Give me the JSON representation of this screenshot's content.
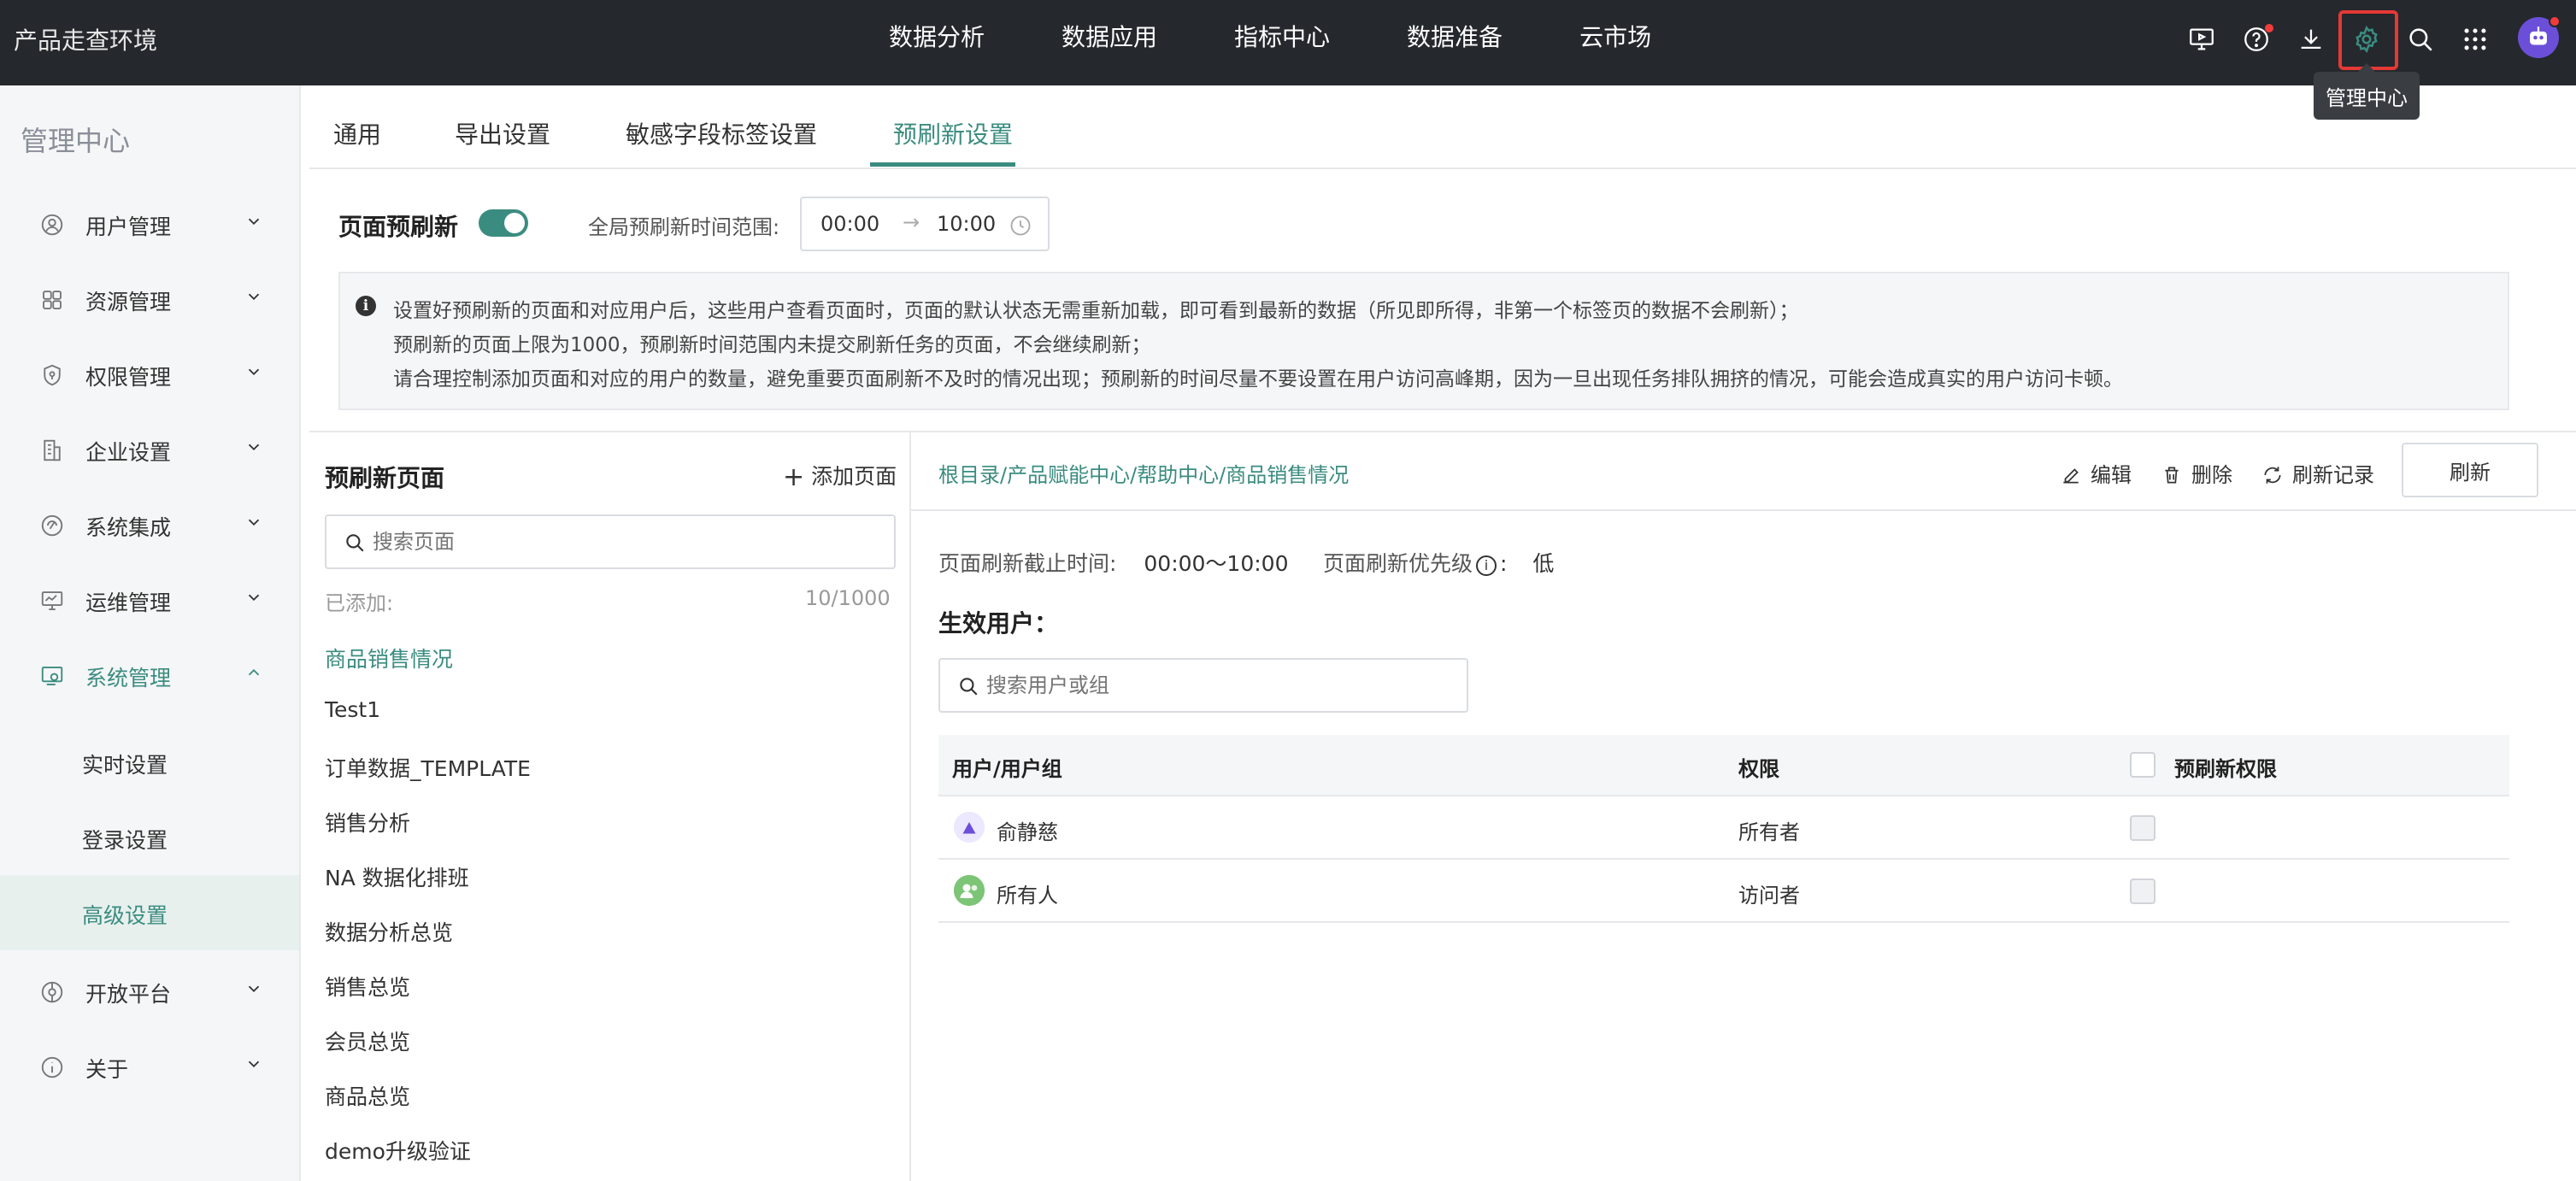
{
  "topbar": {
    "env_title": "产品走查环境",
    "nav": [
      "数据分析",
      "数据应用",
      "指标中心",
      "数据准备",
      "云市场"
    ],
    "icons": [
      "screen-icon",
      "help-icon",
      "download-icon",
      "gear-icon",
      "search-icon",
      "apps-grid-icon"
    ],
    "tooltip": "管理中心",
    "accent_color": "#3b8c80",
    "highlight_color": "#e53935"
  },
  "sidebar": {
    "title": "管理中心",
    "items": [
      {
        "label": "用户管理",
        "icon": "user-icon"
      },
      {
        "label": "资源管理",
        "icon": "resource-icon"
      },
      {
        "label": "权限管理",
        "icon": "shield-icon"
      },
      {
        "label": "企业设置",
        "icon": "building-icon"
      },
      {
        "label": "系统集成",
        "icon": "integration-icon"
      },
      {
        "label": "运维管理",
        "icon": "monitor-icon"
      },
      {
        "label": "系统管理",
        "icon": "system-icon"
      },
      {
        "label": "开放平台",
        "icon": "platform-icon"
      },
      {
        "label": "关于",
        "icon": "info-icon"
      }
    ],
    "sub_items": [
      "实时设置",
      "登录设置",
      "高级设置"
    ]
  },
  "tabs": [
    "通用",
    "导出设置",
    "敏感字段标签设置",
    "预刷新设置"
  ],
  "prefresh": {
    "label": "页面预刷新",
    "enabled": true,
    "range_label": "全局预刷新时间范围:",
    "start": "00:00",
    "arrow": "→",
    "end": "10:00"
  },
  "notice": {
    "lines": [
      "设置好预刷新的页面和对应用户后，这些用户查看页面时，页面的默认状态无需重新加载，即可看到最新的数据（所见即所得，非第一个标签页的数据不会刷新）；",
      "预刷新的页面上限为1000，预刷新时间范围内未提交刷新任务的页面，不会继续刷新；",
      "请合理控制添加页面和对应的用户的数量，避免重要页面刷新不及时的情况出现；预刷新的时间尽量不要设置在用户访问高峰期，因为一旦出现任务排队拥挤的情况，可能会造成真实的用户访问卡顿。"
    ]
  },
  "left_panel": {
    "title": "预刷新页面",
    "add_label": "添加页面",
    "search_placeholder": "搜索页面",
    "added_label": "已添加:",
    "added_count": "10/1000",
    "pages": [
      "商品销售情况",
      "Test1",
      "订单数据_TEMPLATE",
      "销售分析",
      "NA 数据化排班",
      "数据分析总览",
      "销售总览",
      "会员总览",
      "商品总览",
      "demo升级验证"
    ]
  },
  "right_panel": {
    "breadcrumb": "根目录/产品赋能中心/帮助中心/商品销售情况",
    "actions": {
      "edit": "编辑",
      "delete": "删除",
      "history": "刷新记录"
    },
    "refresh_button": "刷新",
    "cutoff_label": "页面刷新截止时间:",
    "cutoff_value": "00:00～10:00",
    "priority_label": "页面刷新优先级",
    "priority_colon": ":",
    "priority_value": "低",
    "users_title": "生效用户：",
    "user_search_placeholder": "搜索用户或组",
    "table": {
      "headers": [
        "用户/用户组",
        "权限",
        "预刷新权限"
      ],
      "rows": [
        {
          "name": "俞静慈",
          "role": "所有者",
          "avatar_color": "#e9e4ff"
        },
        {
          "name": "所有人",
          "role": "访问者",
          "avatar_color": "#7cc576"
        }
      ]
    }
  }
}
